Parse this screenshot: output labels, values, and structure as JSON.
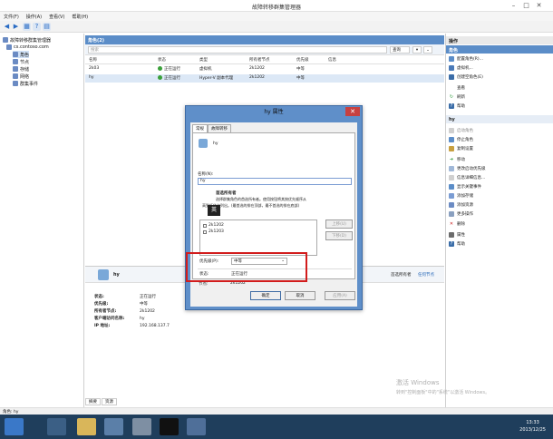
{
  "window": {
    "title": "故障转移群集管理器",
    "min": "–",
    "max": "□",
    "close": "✕"
  },
  "menu": [
    "文件(F)",
    "操作(A)",
    "查看(V)",
    "帮助(H)"
  ],
  "tree": {
    "root": "故障转移群集管理器",
    "cluster": "cs.contoso.com",
    "items": [
      "角色",
      "节点",
      "存储",
      "网络",
      "群集事件"
    ]
  },
  "roles": {
    "header": "角色(2)",
    "search_placeholder": "搜索",
    "query_label": "查询",
    "columns": [
      "名称",
      "状态",
      "类型",
      "所有者节点",
      "优先级",
      "信息"
    ],
    "rows": [
      {
        "name": "2k03",
        "status": "正在运行",
        "type": "虚拟机",
        "owner": "2k1202",
        "priority": "中等",
        "info": ""
      },
      {
        "name": "hy",
        "status": "正在运行",
        "type": "Hyper-V 副本代理",
        "owner": "2k1202",
        "priority": "中等",
        "info": ""
      }
    ]
  },
  "details": {
    "name": "hy",
    "preferred_owner_label": "首选所有者",
    "any_node_link": "任何节点",
    "props": [
      {
        "label": "状态:",
        "value": "正在运行"
      },
      {
        "label": "优先级:",
        "value": "中等"
      },
      {
        "label": "所有者节点:",
        "value": "2k1202"
      },
      {
        "label": "客户端访问名称:",
        "value": "hy"
      },
      {
        "label": "IP 地址:",
        "value": "192.168.137.7"
      }
    ],
    "tabs": [
      "摘要",
      "资源"
    ]
  },
  "actions": {
    "header": "操作",
    "roles_group": "角色",
    "roles_items": [
      "配置角色(R)...",
      "虚拟机...",
      "创建空角色(E)",
      "查看",
      "刷新",
      "帮助"
    ],
    "hy_group": "hy",
    "hy_items": [
      "启动角色",
      "停止角色",
      "复制设置",
      "移动",
      "更改启动优先级",
      "信息详细信息...",
      "显示关键事件",
      "添加存储",
      "添加资源",
      "更多操作",
      "删除",
      "属性",
      "帮助"
    ]
  },
  "statusbar": {
    "text": "角色: hy"
  },
  "watermark": {
    "line1": "激活 Windows",
    "line2": "转到\"控制面板\"中的\"系统\"以激活 Windows。"
  },
  "clock": {
    "time": "13:33",
    "date": "2013/12/25"
  },
  "dialog": {
    "title": "hy 属性",
    "close": "✕",
    "tabs": [
      "常规",
      "故障转移"
    ],
    "role_name": "hy",
    "name_label": "名称(N):",
    "name_value": "hy",
    "preferred_owners_heading": "首选所有者",
    "preferred_owners_desc1": "选择群集角色的首选所有者。使用按钮将其按优先顺序从",
    "preferred_owners_desc2": "高到低依次列出。(最首选的排在顶部，最不首选的排在底部)",
    "ime_char": "英",
    "owners": [
      "2k1202",
      "2k1203"
    ],
    "up_btn": "上移(U)",
    "down_btn": "下移(D)",
    "priority_label": "优先级(P):",
    "priority_value": "中等",
    "status_label": "状态:",
    "status_value": "正在运行",
    "node_label": "节点:",
    "node_value": "2k1202",
    "ok": "确定",
    "cancel": "取消",
    "apply": "应用(A)"
  }
}
